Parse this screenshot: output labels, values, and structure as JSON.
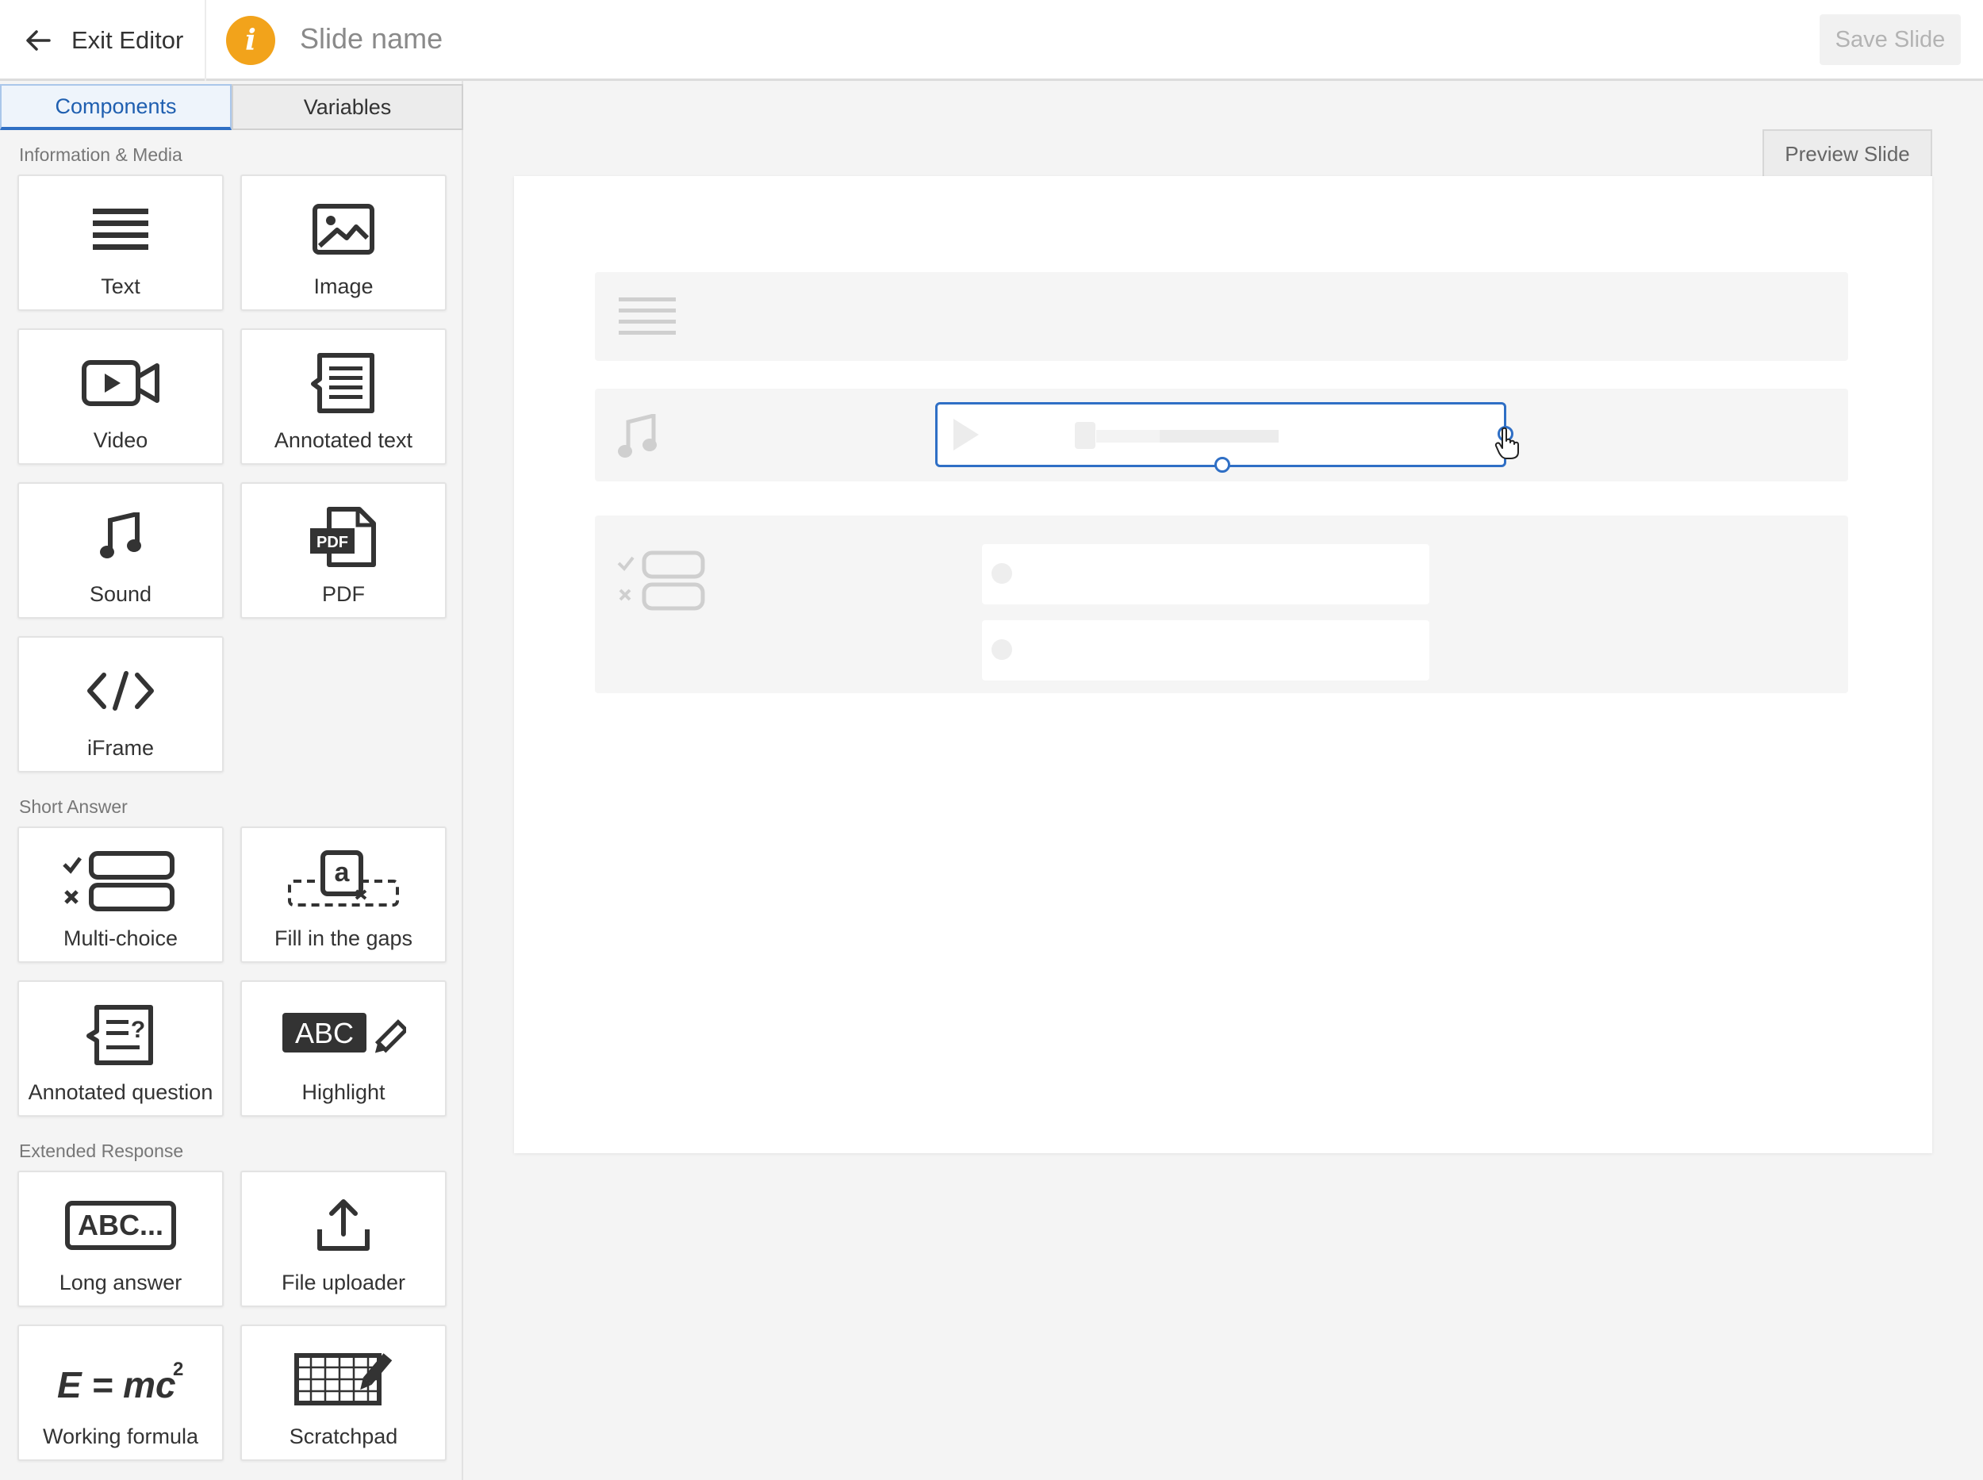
{
  "header": {
    "exit_label": "Exit Editor",
    "info_glyph": "i",
    "slide_name": "Slide name",
    "save_label": "Save Slide"
  },
  "sidebar": {
    "tabs": [
      {
        "label": "Components",
        "active": true
      },
      {
        "label": "Variables",
        "active": false
      }
    ],
    "sections": [
      {
        "title": "Information & Media",
        "items": [
          {
            "label": "Text",
            "icon": "text-lines-icon"
          },
          {
            "label": "Image",
            "icon": "image-icon"
          },
          {
            "label": "Video",
            "icon": "video-camera-icon"
          },
          {
            "label": "Annotated text",
            "icon": "annotated-text-icon"
          },
          {
            "label": "Sound",
            "icon": "music-note-icon"
          },
          {
            "label": "PDF",
            "icon": "pdf-file-icon",
            "icon_text": "PDF"
          },
          {
            "label": "iFrame",
            "icon": "code-brackets-icon"
          }
        ]
      },
      {
        "title": "Short Answer",
        "items": [
          {
            "label": "Multi-choice",
            "icon": "multi-choice-icon"
          },
          {
            "label": "Fill in the gaps",
            "icon": "fill-gaps-icon",
            "icon_text": "a"
          },
          {
            "label": "Annotated question",
            "icon": "annotated-question-icon"
          },
          {
            "label": "Highlight",
            "icon": "highlight-icon",
            "icon_text": "ABC"
          }
        ]
      },
      {
        "title": "Extended Response",
        "items": [
          {
            "label": "Long answer",
            "icon": "long-answer-icon",
            "icon_text": "ABC..."
          },
          {
            "label": "File uploader",
            "icon": "upload-icon"
          },
          {
            "label": "Working formula",
            "icon": "formula-icon",
            "icon_text": "E = mc",
            "icon_sup": "2"
          },
          {
            "label": "Scratchpad",
            "icon": "scratchpad-icon"
          }
        ]
      }
    ]
  },
  "canvas": {
    "preview_label": "Preview Slide",
    "blocks": [
      "text-block",
      "audio-block",
      "multi-choice-block"
    ]
  },
  "colors": {
    "accent": "#2f6fc5",
    "info_badge": "#f2a31b",
    "tab_active_text": "#1f5fb0"
  }
}
